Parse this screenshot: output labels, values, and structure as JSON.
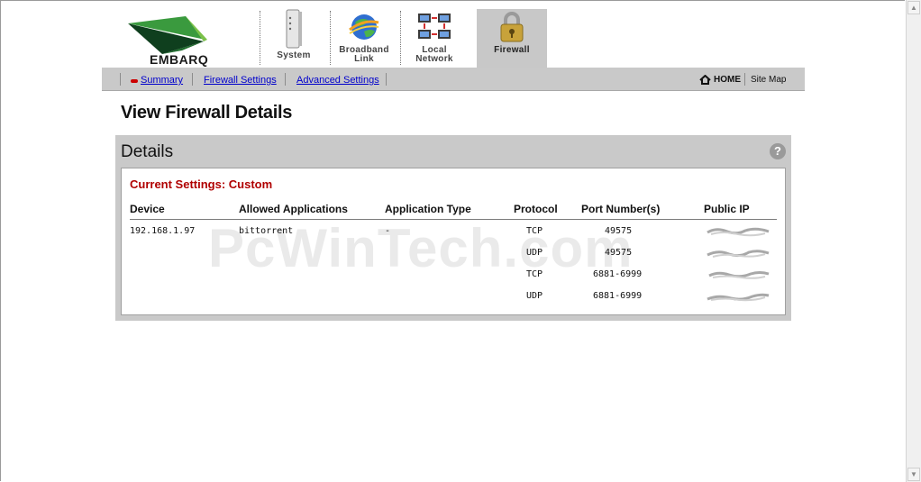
{
  "brand": {
    "name": "EMBARQ",
    "green": "#2f8a3a",
    "dark_green": "#0f3f1e"
  },
  "tabs": [
    {
      "key": "system",
      "line1": "System",
      "line2": "",
      "icon": "modem-icon"
    },
    {
      "key": "broadband",
      "line1": "Broadband",
      "line2": "Link",
      "icon": "globe-icon"
    },
    {
      "key": "local",
      "line1": "Local",
      "line2": "Network",
      "icon": "network-icon"
    },
    {
      "key": "firewall",
      "line1": "Firewall",
      "line2": "",
      "icon": "padlock-icon",
      "active": true
    }
  ],
  "subnav": {
    "items": [
      "Summary",
      "Firewall Settings",
      "Advanced Settings"
    ],
    "home": "HOME",
    "sitemap": "Site Map"
  },
  "page_title": "View Firewall Details",
  "panel": {
    "title": "Details",
    "help": "?",
    "current_settings": "Current Settings: Custom",
    "columns": [
      "Device",
      "Allowed Applications",
      "Application Type",
      "Protocol",
      "Port Number(s)",
      "Public IP"
    ],
    "device": "192.168.1.97",
    "application": "bittorrent",
    "application_type": "-",
    "rows": [
      {
        "protocol": "TCP",
        "ports": "49575"
      },
      {
        "protocol": "UDP",
        "ports": "49575"
      },
      {
        "protocol": "TCP",
        "ports": "6881-6999"
      },
      {
        "protocol": "UDP",
        "ports": "6881-6999"
      }
    ]
  },
  "watermark": "PcWinTech.com",
  "accent": {
    "link": "#0000cc",
    "alert": "#b00000",
    "panel": "#c9c9c9"
  }
}
